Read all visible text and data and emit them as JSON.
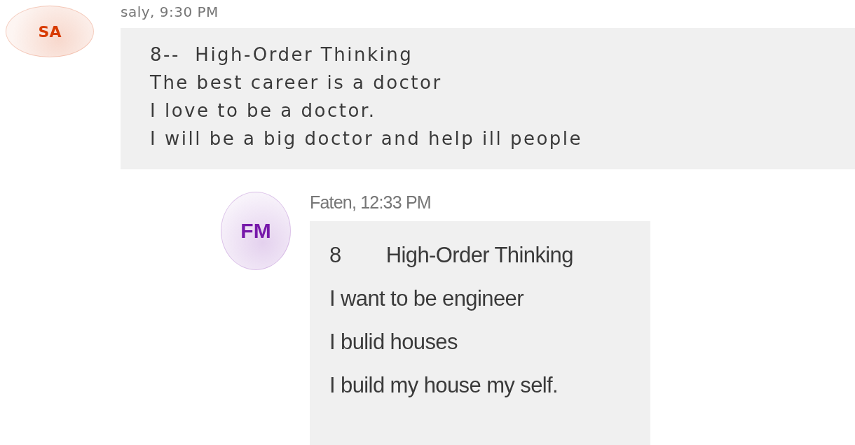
{
  "messages": [
    {
      "kind": "post",
      "initials": "SA",
      "color": "#d83b01",
      "author_time": "saly, 9:30 PM",
      "lines": [
        "8--  High-Order Thinking",
        "The best career is a doctor",
        "I love to be a doctor.",
        "I will be a big doctor and help ill people"
      ]
    },
    {
      "kind": "reply",
      "initials": "FM",
      "color": "#7719aa",
      "author_time": "Faten, 12:33 PM",
      "lines": [
        "8        High-Order Thinking",
        "I want to be engineer",
        "I bulid houses",
        "I build my house my self."
      ]
    }
  ]
}
